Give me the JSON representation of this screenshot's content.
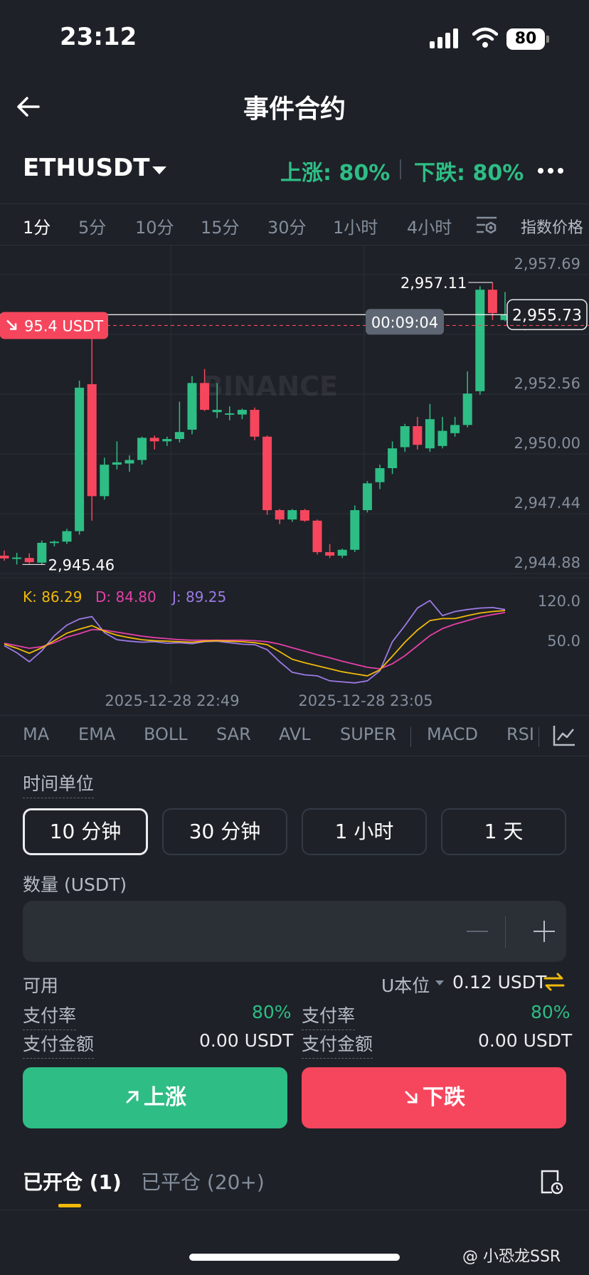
{
  "status_bar": {
    "time": "23:12",
    "battery": "80"
  },
  "nav": {
    "title": "事件合约"
  },
  "pair": {
    "symbol": "ETHUSDT",
    "up_rate": "上涨: 80%",
    "down_rate": "下跌: 80%"
  },
  "timeframes": {
    "items": [
      "1分",
      "5分",
      "10分",
      "15分",
      "30分",
      "1小时",
      "4小时"
    ],
    "index_price": "指数价格"
  },
  "chart_data": {
    "type": "candlestick",
    "watermark": "BINANCE",
    "price_axis": [
      "2,957.69",
      "2,955.12",
      "2,952.56",
      "2,950.00",
      "2,947.44",
      "2,944.88"
    ],
    "ylim": [
      2944.88,
      2957.69
    ],
    "current_price": "2,955.73",
    "current_price_value": 2955.73,
    "countdown": "00:09:04",
    "position_label": "95.4 USDT",
    "position_price_value": 2955.45,
    "high_label": "2,957.11",
    "low_label": "2,945.46",
    "x_labels": [
      "2025-12-28 22:49",
      "2025-12-28 23:05"
    ],
    "candles": [
      {
        "o": 2945.4,
        "h": 2945.62,
        "l": 2945.18,
        "c": 2945.28
      },
      {
        "o": 2945.3,
        "h": 2945.52,
        "l": 2945.02,
        "c": 2945.32
      },
      {
        "o": 2945.3,
        "h": 2945.5,
        "l": 2945.05,
        "c": 2945.12
      },
      {
        "o": 2945.1,
        "h": 2946.05,
        "l": 2945.02,
        "c": 2945.95
      },
      {
        "o": 2945.95,
        "h": 2946.05,
        "l": 2945.8,
        "c": 2946.0
      },
      {
        "o": 2946.0,
        "h": 2946.55,
        "l": 2945.9,
        "c": 2946.45
      },
      {
        "o": 2946.45,
        "h": 2952.9,
        "l": 2946.3,
        "c": 2952.6
      },
      {
        "o": 2952.75,
        "h": 2954.8,
        "l": 2946.9,
        "c": 2947.95
      },
      {
        "o": 2947.95,
        "h": 2949.6,
        "l": 2947.8,
        "c": 2949.3
      },
      {
        "o": 2949.3,
        "h": 2950.3,
        "l": 2949.1,
        "c": 2949.4
      },
      {
        "o": 2949.35,
        "h": 2949.7,
        "l": 2949.0,
        "c": 2949.5
      },
      {
        "o": 2949.5,
        "h": 2950.5,
        "l": 2949.3,
        "c": 2950.45
      },
      {
        "o": 2950.45,
        "h": 2950.55,
        "l": 2949.95,
        "c": 2950.3
      },
      {
        "o": 2950.3,
        "h": 2950.5,
        "l": 2950.1,
        "c": 2950.4
      },
      {
        "o": 2950.4,
        "h": 2952.0,
        "l": 2950.25,
        "c": 2950.7
      },
      {
        "o": 2950.8,
        "h": 2953.1,
        "l": 2950.6,
        "c": 2952.8
      },
      {
        "o": 2952.8,
        "h": 2953.4,
        "l": 2951.6,
        "c": 2951.65
      },
      {
        "o": 2951.55,
        "h": 2952.8,
        "l": 2951.3,
        "c": 2951.65
      },
      {
        "o": 2951.45,
        "h": 2951.8,
        "l": 2951.2,
        "c": 2951.5
      },
      {
        "o": 2951.45,
        "h": 2951.7,
        "l": 2951.25,
        "c": 2951.65
      },
      {
        "o": 2951.65,
        "h": 2951.75,
        "l": 2950.35,
        "c": 2950.5
      },
      {
        "o": 2950.5,
        "h": 2950.55,
        "l": 2947.15,
        "c": 2947.35
      },
      {
        "o": 2947.35,
        "h": 2947.4,
        "l": 2946.75,
        "c": 2946.95
      },
      {
        "o": 2946.95,
        "h": 2947.4,
        "l": 2946.85,
        "c": 2947.35
      },
      {
        "o": 2947.35,
        "h": 2947.4,
        "l": 2946.85,
        "c": 2946.9
      },
      {
        "o": 2946.9,
        "h": 2946.95,
        "l": 2945.45,
        "c": 2945.55
      },
      {
        "o": 2945.55,
        "h": 2945.9,
        "l": 2945.3,
        "c": 2945.4
      },
      {
        "o": 2945.4,
        "h": 2945.7,
        "l": 2945.3,
        "c": 2945.65
      },
      {
        "o": 2945.65,
        "h": 2947.55,
        "l": 2945.55,
        "c": 2947.35
      },
      {
        "o": 2947.35,
        "h": 2948.6,
        "l": 2947.25,
        "c": 2948.5
      },
      {
        "o": 2948.55,
        "h": 2949.3,
        "l": 2948.25,
        "c": 2949.15
      },
      {
        "o": 2949.15,
        "h": 2950.3,
        "l": 2948.9,
        "c": 2950.0
      },
      {
        "o": 2950.05,
        "h": 2951.05,
        "l": 2949.85,
        "c": 2950.95
      },
      {
        "o": 2950.95,
        "h": 2951.35,
        "l": 2949.95,
        "c": 2950.15
      },
      {
        "o": 2950.0,
        "h": 2951.9,
        "l": 2949.85,
        "c": 2951.25
      },
      {
        "o": 2950.1,
        "h": 2951.35,
        "l": 2950.0,
        "c": 2950.75
      },
      {
        "o": 2950.65,
        "h": 2951.35,
        "l": 2950.5,
        "c": 2951.0
      },
      {
        "o": 2951.0,
        "h": 2953.3,
        "l": 2950.9,
        "c": 2952.35
      },
      {
        "o": 2952.45,
        "h": 2956.95,
        "l": 2952.3,
        "c": 2956.8
      },
      {
        "o": 2956.8,
        "h": 2957.11,
        "l": 2955.5,
        "c": 2955.8
      },
      {
        "o": 2955.5,
        "h": 2956.7,
        "l": 2955.45,
        "c": 2955.73
      }
    ],
    "kdj": {
      "k_label": "K: 86.29",
      "d_label": "D: 84.80",
      "j_label": "J: 89.25",
      "axis": [
        "120.0",
        "50.0"
      ],
      "ylim": [
        -20,
        150
      ],
      "k": [
        63,
        55,
        45,
        56,
        70,
        85,
        93,
        100,
        89,
        81,
        76,
        72,
        70,
        69,
        68,
        67,
        69,
        70,
        69,
        68,
        66,
        62,
        48,
        33,
        26,
        20,
        14,
        8,
        4,
        0,
        12,
        39,
        67,
        91,
        110,
        114,
        114,
        120,
        125,
        128,
        130
      ],
      "d": [
        65,
        60,
        55,
        58,
        66,
        77,
        84,
        92,
        91,
        87,
        83,
        79,
        76,
        74,
        72,
        71,
        71,
        71,
        71,
        71,
        70,
        68,
        63,
        56,
        49,
        42,
        36,
        29,
        23,
        17,
        14,
        24,
        40,
        60,
        80,
        94,
        103,
        110,
        117,
        122,
        126
      ],
      "j": [
        60,
        46,
        28,
        50,
        80,
        101,
        113,
        118,
        86,
        72,
        69,
        67,
        68,
        65,
        66,
        64,
        68,
        69,
        66,
        63,
        62,
        52,
        28,
        7,
        2,
        0,
        -10,
        -12,
        -14,
        -10,
        10,
        68,
        100,
        135,
        150,
        120,
        128,
        132,
        135,
        136,
        132
      ]
    }
  },
  "indicators": [
    "MA",
    "EMA",
    "BOLL",
    "SAR",
    "AVL",
    "SUPER",
    "MACD",
    "RSI"
  ],
  "time_unit": {
    "label": "时间单位",
    "options": [
      "10 分钟",
      "30 分钟",
      "1 小时",
      "1 天"
    ],
    "selected": "10 分钟"
  },
  "amount": {
    "label": "数量 (USDT)",
    "value": ""
  },
  "available": {
    "label": "可用",
    "mode": "U本位",
    "value": "0.12 USDT"
  },
  "left_stats": {
    "payout_rate_label": "支付率",
    "payout_rate": "80%",
    "payout_amount_label": "支付金额",
    "payout_amount": "0.00 USDT"
  },
  "right_stats": {
    "payout_rate_label": "支付率",
    "payout_rate": "80%",
    "payout_amount_label": "支付金额",
    "payout_amount": "0.00 USDT"
  },
  "buttons": {
    "up": "上涨",
    "down": "下跌"
  },
  "bottom_tabs": {
    "open": "已开仓 (1)",
    "closed": "已平仓 (20+)"
  },
  "watermark": "@ 小恐龙SSR",
  "colors": {
    "up": "#2ebd85",
    "down": "#f6465d",
    "k": "#f0b90b",
    "d": "#e440a8",
    "j": "#9c7ae6",
    "accent": "#f0b90b"
  }
}
